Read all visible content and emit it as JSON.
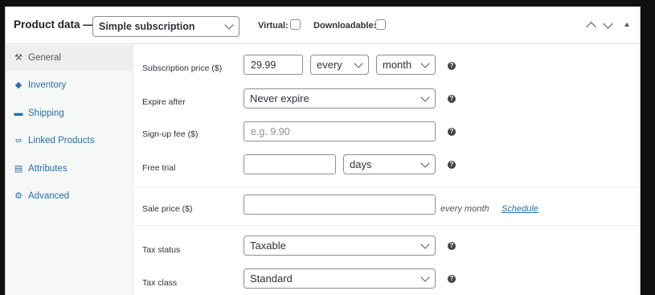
{
  "header": {
    "title": "Product data —",
    "product_type": "Simple subscription",
    "virtual_label": "Virtual:",
    "downloadable_label": "Downloadable:"
  },
  "sidebar": {
    "items": [
      {
        "label": "General",
        "icon": "wrench-icon",
        "active": true
      },
      {
        "label": "Inventory",
        "icon": "tag-icon",
        "active": false
      },
      {
        "label": "Shipping",
        "icon": "truck-icon",
        "active": false
      },
      {
        "label": "Linked Products",
        "icon": "link-icon",
        "active": false
      },
      {
        "label": "Attributes",
        "icon": "list-icon",
        "active": false
      },
      {
        "label": "Advanced",
        "icon": "gear-icon",
        "active": false
      }
    ]
  },
  "fields": {
    "subscription_price": {
      "label": "Subscription price ($)",
      "value": "29.99",
      "interval": "every",
      "period": "month"
    },
    "expire_after": {
      "label": "Expire after",
      "value": "Never expire"
    },
    "signup_fee": {
      "label": "Sign-up fee ($)",
      "placeholder": "e.g. 9.90"
    },
    "free_trial": {
      "label": "Free trial",
      "value": "",
      "period": "days"
    },
    "sale_price": {
      "label": "Sale price ($)",
      "value": "",
      "suffix": "every month",
      "schedule": "Schedule"
    },
    "tax_status": {
      "label": "Tax status",
      "value": "Taxable"
    },
    "tax_class": {
      "label": "Tax class",
      "value": "Standard"
    }
  },
  "colors": {
    "link": "#2271b1",
    "border": "#8c8f94",
    "sidebar_bg": "#f6f7f7"
  }
}
